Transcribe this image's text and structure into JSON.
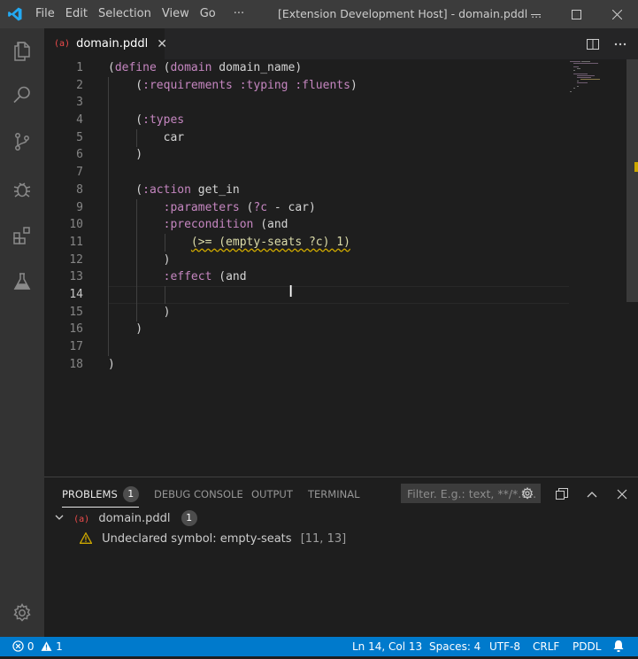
{
  "titlebar": {
    "menu": [
      "File",
      "Edit",
      "Selection",
      "View",
      "Go",
      "···"
    ],
    "window_title": "[Extension Development Host] - domain.pddl ..."
  },
  "activity_bar": {
    "icons": [
      "explorer-icon",
      "search-icon",
      "source-control-icon",
      "debug-icon",
      "extensions-icon",
      "test-icon",
      "settings-gear-icon"
    ]
  },
  "editor_tab": {
    "file_icon": "(a)",
    "file_name": "domain.pddl",
    "close": "✕"
  },
  "editor": {
    "current_line": 14,
    "line_numbers": [
      "1",
      "2",
      "3",
      "4",
      "5",
      "6",
      "7",
      "8",
      "9",
      "10",
      "11",
      "12",
      "13",
      "14",
      "15",
      "16",
      "17",
      "18"
    ],
    "lines": [
      [
        {
          "t": "(",
          "c": "k-par"
        },
        {
          "t": "define",
          "c": "k-kw"
        },
        {
          "t": " (",
          "c": "k-par"
        },
        {
          "t": "domain",
          "c": "k-kw"
        },
        {
          "t": " domain_name)",
          "c": "k-par"
        }
      ],
      [
        {
          "t": "    (",
          "c": "k-par"
        },
        {
          "t": ":requirements :typing :fluents",
          "c": "k-kw"
        },
        {
          "t": ")",
          "c": "k-par"
        }
      ],
      [],
      [
        {
          "t": "    (",
          "c": "k-par"
        },
        {
          "t": ":types",
          "c": "k-kw"
        }
      ],
      [
        {
          "t": "        car",
          "c": "k-par"
        }
      ],
      [
        {
          "t": "    )",
          "c": "k-par"
        }
      ],
      [],
      [
        {
          "t": "    (",
          "c": "k-par"
        },
        {
          "t": ":action",
          "c": "k-kw"
        },
        {
          "t": " get_in",
          "c": "k-par"
        }
      ],
      [
        {
          "t": "        ",
          "c": "k-par"
        },
        {
          "t": ":parameters",
          "c": "k-kw"
        },
        {
          "t": " (",
          "c": "k-par"
        },
        {
          "t": "?c",
          "c": "k-kw"
        },
        {
          "t": " - car)",
          "c": "k-par"
        }
      ],
      [
        {
          "t": "        ",
          "c": "k-par"
        },
        {
          "t": ":precondition",
          "c": "k-kw"
        },
        {
          "t": " (and",
          "c": "k-par"
        }
      ],
      [
        {
          "t": "            ",
          "c": "k-par"
        },
        {
          "t": "(>= (empty-seats ?c) 1)",
          "c": "squig-line"
        }
      ],
      [
        {
          "t": "        )",
          "c": "k-par"
        }
      ],
      [
        {
          "t": "        ",
          "c": "k-par"
        },
        {
          "t": ":effect",
          "c": "k-kw"
        },
        {
          "t": " (and",
          "c": "k-par"
        }
      ],
      [],
      [
        {
          "t": "        )",
          "c": "k-par"
        }
      ],
      [
        {
          "t": "    )",
          "c": "k-par"
        }
      ],
      [],
      [
        {
          "t": ")",
          "c": "k-par"
        }
      ]
    ]
  },
  "panel": {
    "tabs": [
      {
        "label": "PROBLEMS",
        "badge": "1",
        "active": true
      },
      {
        "label": "DEBUG CONSOLE"
      },
      {
        "label": "OUTPUT"
      },
      {
        "label": "TERMINAL"
      }
    ],
    "filter_placeholder": "Filter. E.g.: text, **/*.t...",
    "problems": {
      "file_icon": "(a)",
      "file_name": "domain.pddl",
      "count": "1",
      "items": [
        {
          "severity": "warning",
          "message": "Undeclared symbol: empty-seats",
          "location": "[11, 13]"
        }
      ]
    }
  },
  "statusbar": {
    "errors": "0",
    "warnings": "1",
    "position": "Ln 14, Col 13",
    "spaces": "Spaces: 4",
    "encoding": "UTF-8",
    "eol": "CRLF",
    "language": "PDDL"
  },
  "colors": {
    "statusbar": "#007acc",
    "activitybar": "#333333",
    "titlebar": "#3c3c3c",
    "editor_bg": "#1e1e1e",
    "keyword": "#c586c0",
    "warning": "#cca700",
    "error_icon": "#f14c4c"
  }
}
